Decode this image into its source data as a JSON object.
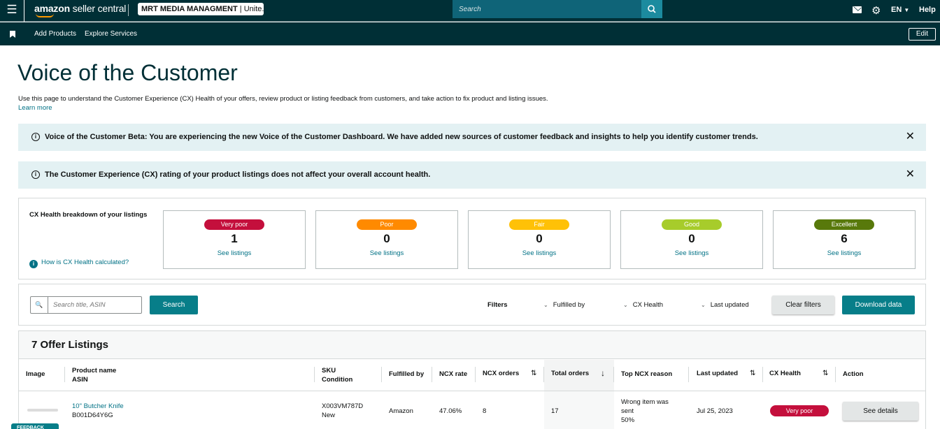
{
  "colors": {
    "nav_bg": "#002f36",
    "accent": "#077e89",
    "very_poor": "#c40f3c",
    "poor": "#ff8a00",
    "fair": "#ffc107",
    "good": "#a7cc2b",
    "excellent": "#58790b"
  },
  "topbar": {
    "menu_icon": "hamburger-icon",
    "logo_brand": "amazon",
    "logo_product": "seller central",
    "account_name": "MRT MEDIA MANAGMENT",
    "account_region": "Unite...",
    "search_placeholder": "Search",
    "language": "EN",
    "help": "Help"
  },
  "subnav": {
    "items": [
      "Add Products",
      "Explore Services"
    ],
    "edit": "Edit"
  },
  "page": {
    "title": "Voice of the Customer",
    "description": "Use this page to understand the Customer Experience (CX) Health of your offers, review product or listing feedback from customers, and take action to fix product and listing issues.",
    "learn_more": "Learn more"
  },
  "alerts": [
    {
      "text": "Voice of the Customer Beta: You are experiencing the new Voice of the Customer Dashboard. We have added new sources of customer feedback and insights to help you identify customer trends."
    },
    {
      "text": "The Customer Experience (CX) rating of your product listings does not affect your overall account health."
    }
  ],
  "cx_health": {
    "title": "CX Health breakdown of your listings",
    "how_link": "How is CX Health calculated?",
    "cards": [
      {
        "label": "Very poor",
        "count": "1",
        "link": "See listings"
      },
      {
        "label": "Poor",
        "count": "0",
        "link": "See listings"
      },
      {
        "label": "Fair",
        "count": "0",
        "link": "See listings"
      },
      {
        "label": "Good",
        "count": "0",
        "link": "See listings"
      },
      {
        "label": "Excellent",
        "count": "6",
        "link": "See listings"
      }
    ]
  },
  "filters": {
    "search_placeholder": "Search title, ASIN",
    "search_button": "Search",
    "label": "Filters",
    "dropdowns": [
      "Fulfilled by",
      "CX Health",
      "Last updated"
    ],
    "clear": "Clear filters",
    "download": "Download data"
  },
  "table": {
    "title": "7 Offer Listings",
    "headers": {
      "image": "Image",
      "product_name": "Product name",
      "asin": "ASIN",
      "sku": "SKU",
      "condition": "Condition",
      "fulfilled_by": "Fulfilled by",
      "ncx_rate": "NCX rate",
      "ncx_orders": "NCX orders",
      "total_orders": "Total orders",
      "top_reason": "Top NCX reason",
      "last_updated": "Last updated",
      "cx_health": "CX Health",
      "action": "Action"
    },
    "rows": [
      {
        "product_name": "10\" Butcher Knife",
        "asin": "B001D64Y6G",
        "sku": "X003VM787D",
        "condition": "New",
        "fulfilled_by": "Amazon",
        "ncx_rate": "47.06%",
        "ncx_orders": "8",
        "total_orders": "17",
        "top_reason_1": "Wrong item was",
        "top_reason_2": "sent",
        "top_reason_3": "50%",
        "last_updated": "Jul 25, 2023",
        "cx_health": "Very poor",
        "action": "See details"
      }
    ]
  },
  "feedback": "FEEDBACK"
}
